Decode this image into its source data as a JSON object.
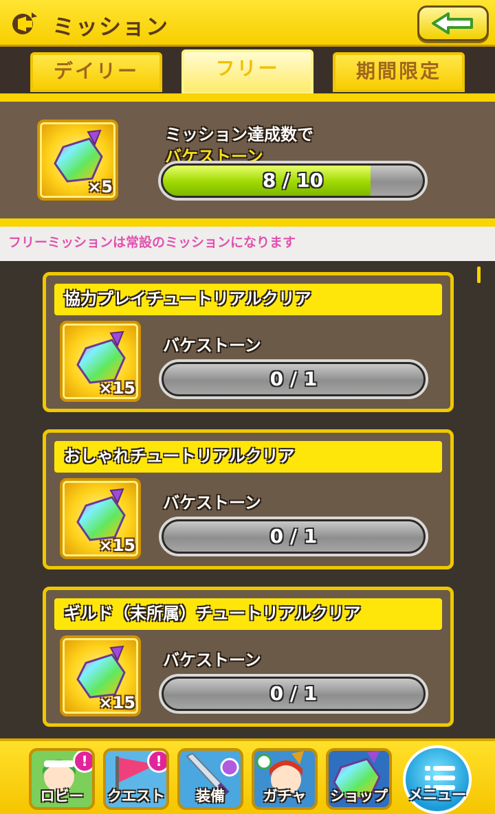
{
  "header": {
    "title": "ミッション",
    "icon": "megaphone-icon",
    "back_icon": "back-arrow-icon"
  },
  "tabs": [
    {
      "label": "デイリー",
      "active": false
    },
    {
      "label": "フリー",
      "active": true
    },
    {
      "label": "期間限定",
      "active": false
    }
  ],
  "summary": {
    "title": "ミッション達成数で",
    "reward_name": "バケストーン",
    "reward_qty": "×5",
    "progress_text": "8 / 10",
    "progress": 0.8
  },
  "notice": "フリーミッションは常設のミッションになります",
  "missions": [
    {
      "title": "協力プレイチュートリアルクリア",
      "reward_name": "バケストーン",
      "reward_qty": "×15",
      "progress_text": "0 / 1",
      "progress": 0
    },
    {
      "title": "おしゃれチュートリアルクリア",
      "reward_name": "バケストーン",
      "reward_qty": "×15",
      "progress_text": "0 / 1",
      "progress": 0
    },
    {
      "title": "ギルド（未所属）チュートリアルクリア",
      "reward_name": "バケストーン",
      "reward_qty": "×15",
      "progress_text": "0 / 1",
      "progress": 0
    }
  ],
  "bottom_nav": [
    {
      "label": "ロビー",
      "badge": "!"
    },
    {
      "label": "クエスト",
      "badge": "!"
    },
    {
      "label": "装備",
      "badge": ""
    },
    {
      "label": "ガチャ",
      "badge": ""
    },
    {
      "label": "ショップ",
      "badge": ""
    },
    {
      "label": "メニュー",
      "badge": ""
    }
  ],
  "colors": {
    "accent_yellow": "#f8d400",
    "progress_green": "#9fd800",
    "notice_pink": "#e24fb0",
    "panel_brown": "#6b5a48"
  }
}
